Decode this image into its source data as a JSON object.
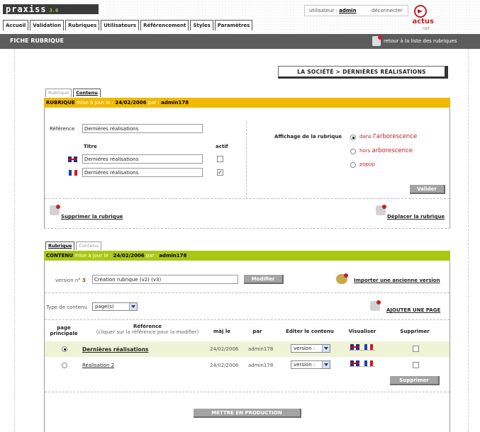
{
  "header": {
    "logo": "praxiss",
    "version": "3.0",
    "user_label": "utilisateur :",
    "user_name": "admin",
    "logout": "déconnecter",
    "brand": "actus",
    "brand_sub": "net"
  },
  "nav": {
    "tabs": [
      "Accueil",
      "Validation",
      "Rubriques",
      "Utilisateurs",
      "Référencement",
      "Styles",
      "Paramètres"
    ]
  },
  "titlebar": {
    "title": "FICHE RUBRIQUE",
    "back": "retour à la liste des rubriques"
  },
  "breadcrumb": "LA SOCIÉTÉ > DERNIÈRES RÉALISATIONS",
  "rubrique_panel": {
    "tabs": [
      "Rubrique",
      "Contenu"
    ],
    "head_label": "RUBRIQUE",
    "head_updated": "mise à jour le :",
    "head_date": "24/02/2006",
    "head_by": "par :",
    "head_user": "admin178",
    "reference_label": "Référence",
    "reference_value": "Dernières réalisations",
    "titre_label": "Titre",
    "actif_label": "actif",
    "titre_en": "Dernières réalisations",
    "titre_fr": "Dernières réalisations",
    "actif_en": "",
    "actif_fr": "✓",
    "affichage_label": "Affichage de la rubrique",
    "opt1_small": "dans",
    "opt1_big": "l'arborescence",
    "opt2_small": "hors",
    "opt2_big": "arborescence",
    "opt3": "popup",
    "valider": "Valider",
    "supprimer": "Supprimer la rubrique",
    "deplacer": "Déplacer la rubrique"
  },
  "contenu_panel": {
    "tabs": [
      "Rubrique",
      "Contenu"
    ],
    "head_label": "CONTENU",
    "head_updated": "mise à jour le :",
    "head_date": "24/02/2006",
    "head_by": "par :",
    "head_user": "admin178",
    "version_label": "version n°",
    "version_num": "3",
    "version_value": "Création rubrique (v2) (v3)",
    "modifier": "Modifier",
    "importer": "Importer une ancienne version",
    "type_label": "Type de contenu",
    "type_value": "page(s)",
    "ajouter": "AJOUTER UNE PAGE",
    "columns": {
      "principale": "page principale",
      "reference": "Référence",
      "reference_hint": "(cliquer sur la référence pour la modifier)",
      "maj": "màj le",
      "par": "par",
      "editer": "Editer le contenu",
      "visualiser": "Visualiser",
      "supprimer": "Supprimer"
    },
    "rows": [
      {
        "reference": "Dernières réalisations",
        "date": "24/02/2006",
        "user": "admin178",
        "version": "version :"
      },
      {
        "reference": "Réalisation 2",
        "date": "24/02/2006",
        "user": "admin178",
        "version": "version :"
      }
    ],
    "supprimer_btn": "Supprimer",
    "production_btn": "METTRE EN PRODUCTION"
  }
}
